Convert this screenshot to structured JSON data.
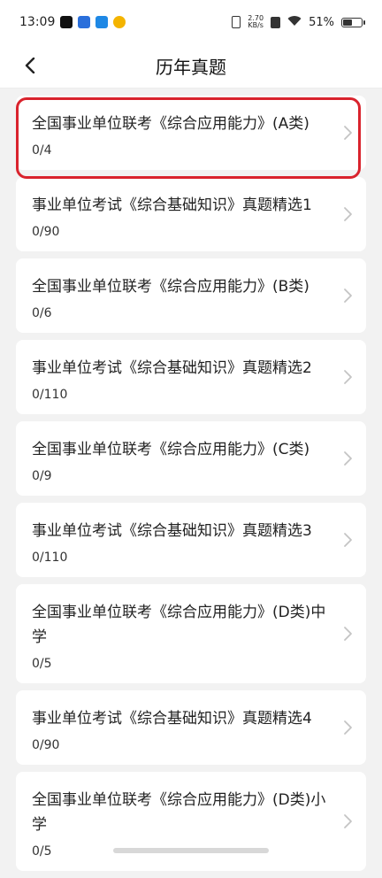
{
  "status": {
    "time": "13:09",
    "net_speed_top": "2.70",
    "net_speed_bottom": "KB/s",
    "battery": "51%",
    "battery_level": 0.51
  },
  "header": {
    "title": "历年真题"
  },
  "items": [
    {
      "title": "全国事业单位联考《综合应用能力》(A类)",
      "count": "0/4"
    },
    {
      "title": "事业单位考试《综合基础知识》真题精选1",
      "count": "0/90"
    },
    {
      "title": "全国事业单位联考《综合应用能力》(B类)",
      "count": "0/6"
    },
    {
      "title": "事业单位考试《综合基础知识》真题精选2",
      "count": "0/110"
    },
    {
      "title": "全国事业单位联考《综合应用能力》(C类)",
      "count": "0/9"
    },
    {
      "title": "事业单位考试《综合基础知识》真题精选3",
      "count": "0/110"
    },
    {
      "title": "全国事业单位联考《综合应用能力》(D类)中学",
      "count": "0/5"
    },
    {
      "title": "事业单位考试《综合基础知识》真题精选4",
      "count": "0/90"
    },
    {
      "title": "全国事业单位联考《综合应用能力》(D类)小学",
      "count": "0/5"
    }
  ],
  "icons": {
    "back": "chevron-left-icon",
    "row_arrow": "chevron-right-icon"
  },
  "colors": {
    "highlight": "#d9232d",
    "background": "#f2f2f2"
  }
}
